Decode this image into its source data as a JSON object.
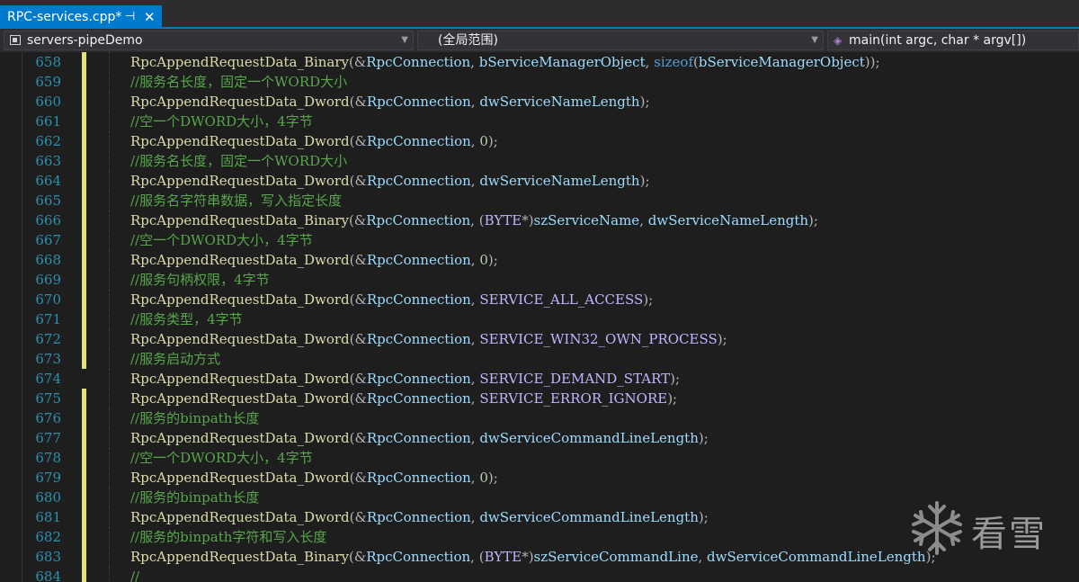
{
  "tab": {
    "title": "RPC-services.cpp*",
    "pin_icon": "pin-icon",
    "close_icon": "close-icon"
  },
  "nav": {
    "project": "servers-pipeDemo",
    "scope": "(全局范围)",
    "member": "main(int argc, char * argv[])"
  },
  "colors": {
    "accent": "#007acc",
    "background": "#1e1e1e",
    "line_number": "#2b91af",
    "function": "#dcdcaa",
    "variable": "#9cdcfe",
    "comment": "#57a64a",
    "macro": "#beb7ff",
    "keyword": "#569cd6",
    "change_marker": "#e4e476"
  },
  "lines": [
    {
      "n": "658",
      "tokens": [
        [
          "fn",
          "RpcAppendRequestData_Binary"
        ],
        [
          "pu",
          "(&"
        ],
        [
          "va",
          "RpcConnection"
        ],
        [
          "pu",
          ", "
        ],
        [
          "va",
          "bServiceManagerObject"
        ],
        [
          "pu",
          ", "
        ],
        [
          "kw",
          "sizeof"
        ],
        [
          "pu",
          "("
        ],
        [
          "va",
          "bServiceManagerObject"
        ],
        [
          "pu",
          "));"
        ]
      ]
    },
    {
      "n": "659",
      "tokens": [
        [
          "cm",
          "//服务名长度，固定一个WORD大小"
        ]
      ]
    },
    {
      "n": "660",
      "tokens": [
        [
          "fn",
          "RpcAppendRequestData_Dword"
        ],
        [
          "pu",
          "(&"
        ],
        [
          "va",
          "RpcConnection"
        ],
        [
          "pu",
          ", "
        ],
        [
          "va",
          "dwServiceNameLength"
        ],
        [
          "pu",
          ");"
        ]
      ]
    },
    {
      "n": "661",
      "tokens": [
        [
          "cm",
          "//空一个DWORD大小，4字节"
        ]
      ]
    },
    {
      "n": "662",
      "tokens": [
        [
          "fn",
          "RpcAppendRequestData_Dword"
        ],
        [
          "pu",
          "(&"
        ],
        [
          "va",
          "RpcConnection"
        ],
        [
          "pu",
          ", "
        ],
        [
          "nu",
          "0"
        ],
        [
          "pu",
          ");"
        ]
      ]
    },
    {
      "n": "663",
      "tokens": [
        [
          "cm",
          "//服务名长度，固定一个WORD大小"
        ]
      ]
    },
    {
      "n": "664",
      "tokens": [
        [
          "fn",
          "RpcAppendRequestData_Dword"
        ],
        [
          "pu",
          "(&"
        ],
        [
          "va",
          "RpcConnection"
        ],
        [
          "pu",
          ", "
        ],
        [
          "va",
          "dwServiceNameLength"
        ],
        [
          "pu",
          ");"
        ]
      ]
    },
    {
      "n": "665",
      "tokens": [
        [
          "cm",
          "//服务名字符串数据，写入指定长度"
        ]
      ]
    },
    {
      "n": "666",
      "tokens": [
        [
          "fn",
          "RpcAppendRequestData_Binary"
        ],
        [
          "pu",
          "(&"
        ],
        [
          "va",
          "RpcConnection"
        ],
        [
          "pu",
          ", ("
        ],
        [
          "mc",
          "BYTE"
        ],
        [
          "pu",
          "*)"
        ],
        [
          "va",
          "szServiceName"
        ],
        [
          "pu",
          ", "
        ],
        [
          "va",
          "dwServiceNameLength"
        ],
        [
          "pu",
          ");"
        ]
      ]
    },
    {
      "n": "667",
      "tokens": [
        [
          "cm",
          "//空一个DWORD大小，4字节"
        ]
      ]
    },
    {
      "n": "668",
      "tokens": [
        [
          "fn",
          "RpcAppendRequestData_Dword"
        ],
        [
          "pu",
          "(&"
        ],
        [
          "va",
          "RpcConnection"
        ],
        [
          "pu",
          ", "
        ],
        [
          "nu",
          "0"
        ],
        [
          "pu",
          ");"
        ]
      ]
    },
    {
      "n": "669",
      "tokens": [
        [
          "cm",
          "//服务句柄权限，4字节"
        ]
      ]
    },
    {
      "n": "670",
      "tokens": [
        [
          "fn",
          "RpcAppendRequestData_Dword"
        ],
        [
          "pu",
          "(&"
        ],
        [
          "va",
          "RpcConnection"
        ],
        [
          "pu",
          ", "
        ],
        [
          "mc",
          "SERVICE_ALL_ACCESS"
        ],
        [
          "pu",
          ");"
        ]
      ]
    },
    {
      "n": "671",
      "tokens": [
        [
          "cm",
          "//服务类型，4字节"
        ]
      ]
    },
    {
      "n": "672",
      "tokens": [
        [
          "fn",
          "RpcAppendRequestData_Dword"
        ],
        [
          "pu",
          "(&"
        ],
        [
          "va",
          "RpcConnection"
        ],
        [
          "pu",
          ", "
        ],
        [
          "mc",
          "SERVICE_WIN32_OWN_PROCESS"
        ],
        [
          "pu",
          ");"
        ]
      ]
    },
    {
      "n": "673",
      "tokens": [
        [
          "cm",
          "//服务启动方式"
        ]
      ]
    },
    {
      "n": "674",
      "tokens": [
        [
          "fn",
          "RpcAppendRequestData_Dword"
        ],
        [
          "pu",
          "(&"
        ],
        [
          "va",
          "RpcConnection"
        ],
        [
          "pu",
          ", "
        ],
        [
          "mc",
          "SERVICE_DEMAND_START"
        ],
        [
          "pu",
          ");"
        ]
      ]
    },
    {
      "n": "675",
      "tokens": [
        [
          "fn",
          "RpcAppendRequestData_Dword"
        ],
        [
          "pu",
          "(&"
        ],
        [
          "va",
          "RpcConnection"
        ],
        [
          "pu",
          ", "
        ],
        [
          "mc",
          "SERVICE_ERROR_IGNORE"
        ],
        [
          "pu",
          ");"
        ]
      ]
    },
    {
      "n": "676",
      "tokens": [
        [
          "cm",
          "//服务的binpath长度"
        ]
      ]
    },
    {
      "n": "677",
      "tokens": [
        [
          "fn",
          "RpcAppendRequestData_Dword"
        ],
        [
          "pu",
          "(&"
        ],
        [
          "va",
          "RpcConnection"
        ],
        [
          "pu",
          ", "
        ],
        [
          "va",
          "dwServiceCommandLineLength"
        ],
        [
          "pu",
          ");"
        ]
      ]
    },
    {
      "n": "678",
      "tokens": [
        [
          "cm",
          "//空一个DWORD大小，4字节"
        ]
      ]
    },
    {
      "n": "679",
      "tokens": [
        [
          "fn",
          "RpcAppendRequestData_Dword"
        ],
        [
          "pu",
          "(&"
        ],
        [
          "va",
          "RpcConnection"
        ],
        [
          "pu",
          ", "
        ],
        [
          "nu",
          "0"
        ],
        [
          "pu",
          ");"
        ]
      ]
    },
    {
      "n": "680",
      "tokens": [
        [
          "cm",
          "//服务的binpath长度"
        ]
      ]
    },
    {
      "n": "681",
      "tokens": [
        [
          "fn",
          "RpcAppendRequestData_Dword"
        ],
        [
          "pu",
          "(&"
        ],
        [
          "va",
          "RpcConnection"
        ],
        [
          "pu",
          ", "
        ],
        [
          "va",
          "dwServiceCommandLineLength"
        ],
        [
          "pu",
          ");"
        ]
      ]
    },
    {
      "n": "682",
      "tokens": [
        [
          "cm",
          "//服务的binpath字符和写入长度"
        ]
      ]
    },
    {
      "n": "683",
      "tokens": [
        [
          "fn",
          "RpcAppendRequestData_Binary"
        ],
        [
          "pu",
          "(&"
        ],
        [
          "va",
          "RpcConnection"
        ],
        [
          "pu",
          ", ("
        ],
        [
          "mc",
          "BYTE"
        ],
        [
          "pu",
          "*)"
        ],
        [
          "va",
          "szServiceCommandLine"
        ],
        [
          "pu",
          ", "
        ],
        [
          "va",
          "dwServiceCommandLineLength"
        ],
        [
          "pu",
          ");"
        ]
      ]
    },
    {
      "n": "684",
      "tokens": [
        [
          "cm",
          "//"
        ]
      ]
    }
  ],
  "watermark": {
    "text": "看雪",
    "icon": "snowflake-icon"
  }
}
